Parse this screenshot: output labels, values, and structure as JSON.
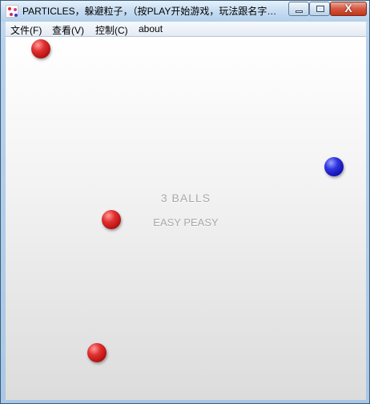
{
  "window": {
    "title": "PARTICLES，躲避粒子，（按PLAY开始游戏，玩法跟名字…",
    "controls": {
      "close_glyph": "X"
    }
  },
  "menu": {
    "items": [
      "文件(F)",
      "查看(V)",
      "控制(C)",
      "about"
    ]
  },
  "game": {
    "status_line_1": "3 BALLS",
    "status_line_2": "EASY PEASY",
    "balls": [
      {
        "color": "red"
      },
      {
        "color": "blue"
      },
      {
        "color": "red"
      },
      {
        "color": "red"
      }
    ]
  },
  "colors": {
    "ball_red": "#e03030",
    "ball_blue": "#3036e0",
    "status_text": "#a8a8a8"
  }
}
